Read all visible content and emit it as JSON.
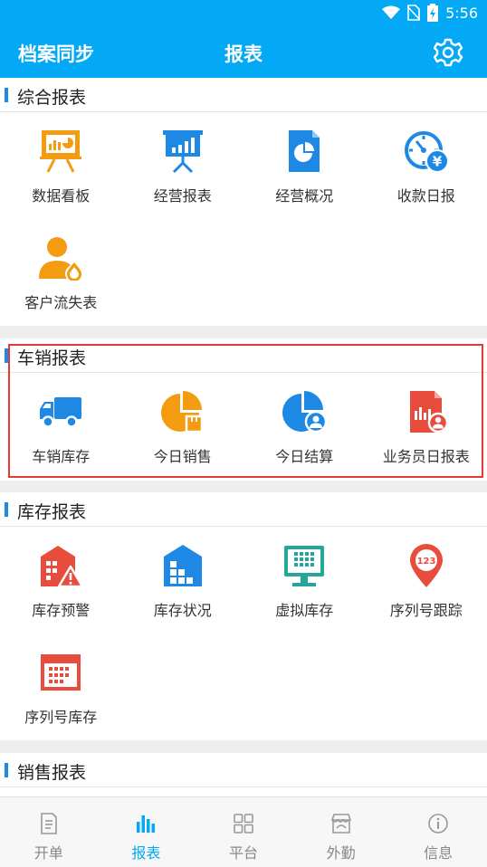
{
  "status": {
    "time": "5:56"
  },
  "appbar": {
    "left": "档案同步",
    "title": "报表"
  },
  "sections": [
    {
      "title": "综合报表",
      "items": [
        {
          "label": "数据看板",
          "icon": "dashboard-board-icon"
        },
        {
          "label": "经营报表",
          "icon": "presentation-chart-icon"
        },
        {
          "label": "经营概况",
          "icon": "pie-document-icon"
        },
        {
          "label": "收款日报",
          "icon": "yuan-clock-icon"
        },
        {
          "label": "客户流失表",
          "icon": "customer-loss-icon"
        }
      ]
    },
    {
      "title": "车销报表",
      "items": [
        {
          "label": "车销库存",
          "icon": "truck-icon"
        },
        {
          "label": "今日销售",
          "icon": "pie-box-icon"
        },
        {
          "label": "今日结算",
          "icon": "pie-user-icon"
        },
        {
          "label": "业务员日报表",
          "icon": "salesman-report-icon"
        }
      ]
    },
    {
      "title": "库存报表",
      "items": [
        {
          "label": "库存预警",
          "icon": "warehouse-warning-icon"
        },
        {
          "label": "库存状况",
          "icon": "warehouse-status-icon"
        },
        {
          "label": "虚拟库存",
          "icon": "monitor-grid-icon"
        },
        {
          "label": "序列号跟踪",
          "icon": "location-123-icon"
        },
        {
          "label": "序列号库存",
          "icon": "calendar-grid-icon"
        }
      ]
    },
    {
      "title": "销售报表",
      "items": []
    }
  ],
  "bottom_nav": [
    {
      "label": "开单",
      "icon": "document-icon"
    },
    {
      "label": "报表",
      "icon": "bar-chart-icon",
      "active": true
    },
    {
      "label": "平台",
      "icon": "grid-icon"
    },
    {
      "label": "外勤",
      "icon": "store-icon"
    },
    {
      "label": "信息",
      "icon": "info-icon"
    }
  ],
  "colors": {
    "primary": "#03A9F4",
    "orange": "#F39C12",
    "blue": "#1E88E5",
    "red": "#E74C3C",
    "teal": "#26A69A",
    "highlight": "#E53935"
  }
}
